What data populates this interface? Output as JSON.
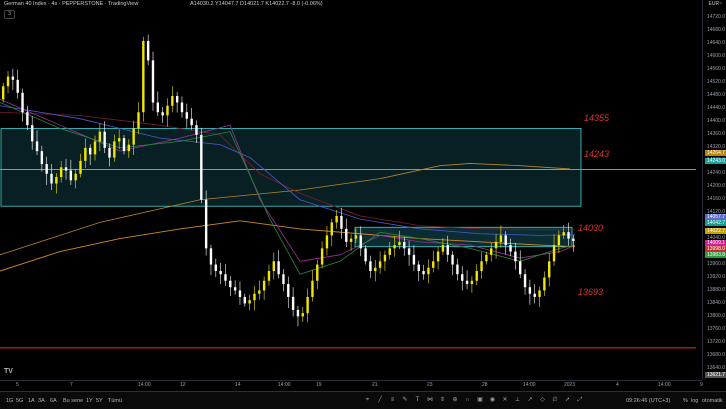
{
  "header": {
    "title": "German 40 Index · 4s · PEPPERSTONE · TradingView",
    "ohlc": "A14030.2  Y14047.7  D14021.7  K14022.7  -8.0 (-0.06%)",
    "currency": "EUR~",
    "collapse_label": "3"
  },
  "price_axis": {
    "labels": [
      "14720.0",
      "14680.0",
      "14640.0",
      "14600.0",
      "14560.0",
      "14520.0",
      "14480.0",
      "14440.0",
      "14400.0",
      "14360.0",
      "14320.0",
      "14280.0",
      "14240.0",
      "14200.0",
      "14160.0",
      "14120.0",
      "14080.0",
      "14040.0",
      "14000.0",
      "13960.0",
      "13920.0",
      "13880.0",
      "13840.0",
      "13800.0",
      "13760.0",
      "13720.0",
      "13680.0",
      "13640.0"
    ],
    "badges": [
      {
        "text": "14264.7",
        "color": "#b8860b"
      },
      {
        "text": "14243.0",
        "color": "#1aa0a0"
      },
      {
        "text": "14057.7",
        "color": "#5a6acf"
      },
      {
        "text": "14042.7",
        "color": "#1a9a8a"
      },
      {
        "text": "14022.7",
        "color": "#c4a000"
      },
      {
        "text": "14009.1",
        "color": "#d02090"
      },
      {
        "text": "13998.0",
        "color": "#c03030"
      },
      {
        "text": "13983.8",
        "color": "#2a9a3a"
      },
      {
        "text": "13621.7",
        "color": "#555555"
      }
    ]
  },
  "annotations": {
    "level_14355": "14355",
    "level_14243": "14243",
    "level_14030": "14030",
    "level_13693": "13693"
  },
  "time_axis": {
    "labels": [
      "5",
      "7",
      "14:00",
      "12",
      "14",
      "14:00",
      "19",
      "21",
      "23",
      "28",
      "14:00",
      "2023",
      "4",
      "14:00",
      "9"
    ]
  },
  "toolbar": {
    "timeframes": [
      "1G",
      "5G",
      "1A",
      "3A",
      "6A",
      "Bu sene",
      "1Y",
      "5Y",
      "Tümü"
    ],
    "clock": "09:26:46 (UTC+3)",
    "pct": "%",
    "log": "log",
    "auto": "otomatik"
  },
  "colors": {
    "up": "#f2e600",
    "down": "#ffffff",
    "box_fill": "#0f3f47",
    "box_border": "#3fd0d0",
    "support": "#e02020"
  }
}
